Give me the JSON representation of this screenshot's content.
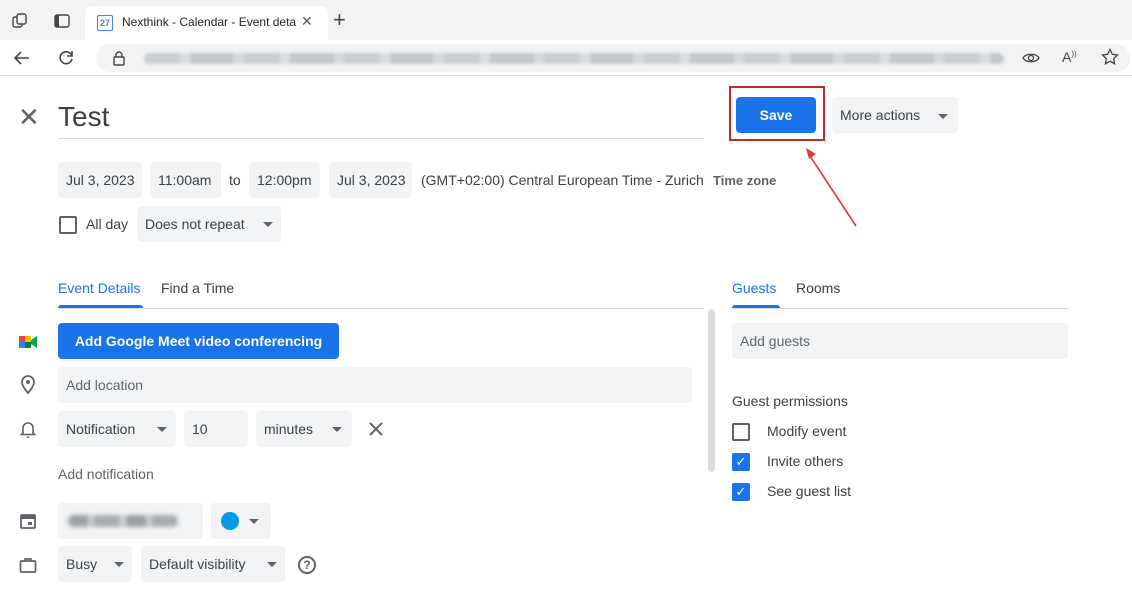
{
  "browser": {
    "tab_title": "Nexthink - Calendar - Event deta",
    "tab_favicon_text": "27",
    "new_tab": "+",
    "tab_close": "✕"
  },
  "event": {
    "close_glyph": "✕",
    "title": "Test",
    "save_label": "Save",
    "more_actions_label": "More actions",
    "start_date": "Jul 3, 2023",
    "start_time": "11:00am",
    "to_label": "to",
    "end_time": "12:00pm",
    "end_date": "Jul 3, 2023",
    "timezone_text": "(GMT+02:00) Central European Time - Zurich",
    "timezone_link": "Time zone",
    "all_day_label": "All day",
    "repeat_value": "Does not repeat"
  },
  "left_tabs": [
    {
      "label": "Event Details",
      "active": true
    },
    {
      "label": "Find a Time",
      "active": false
    }
  ],
  "details": {
    "meet_button": "Add Google Meet video conferencing",
    "location_placeholder": "Add location",
    "notification_type": "Notification",
    "notification_amount": "10",
    "notification_unit": "minutes",
    "add_notification": "Add notification",
    "busy_value": "Busy",
    "visibility_value": "Default visibility",
    "help_glyph": "?"
  },
  "right_tabs": [
    {
      "label": "Guests",
      "active": true
    },
    {
      "label": "Rooms",
      "active": false
    }
  ],
  "guests": {
    "add_guests_placeholder": "Add guests",
    "permissions_title": "Guest permissions",
    "permissions": [
      {
        "label": "Modify event",
        "checked": false
      },
      {
        "label": "Invite others",
        "checked": true
      },
      {
        "label": "See guest list",
        "checked": true
      }
    ]
  },
  "colors": {
    "accent": "#1a73e8",
    "highlight_box": "#c62828",
    "calendar_color": "#039be5"
  }
}
